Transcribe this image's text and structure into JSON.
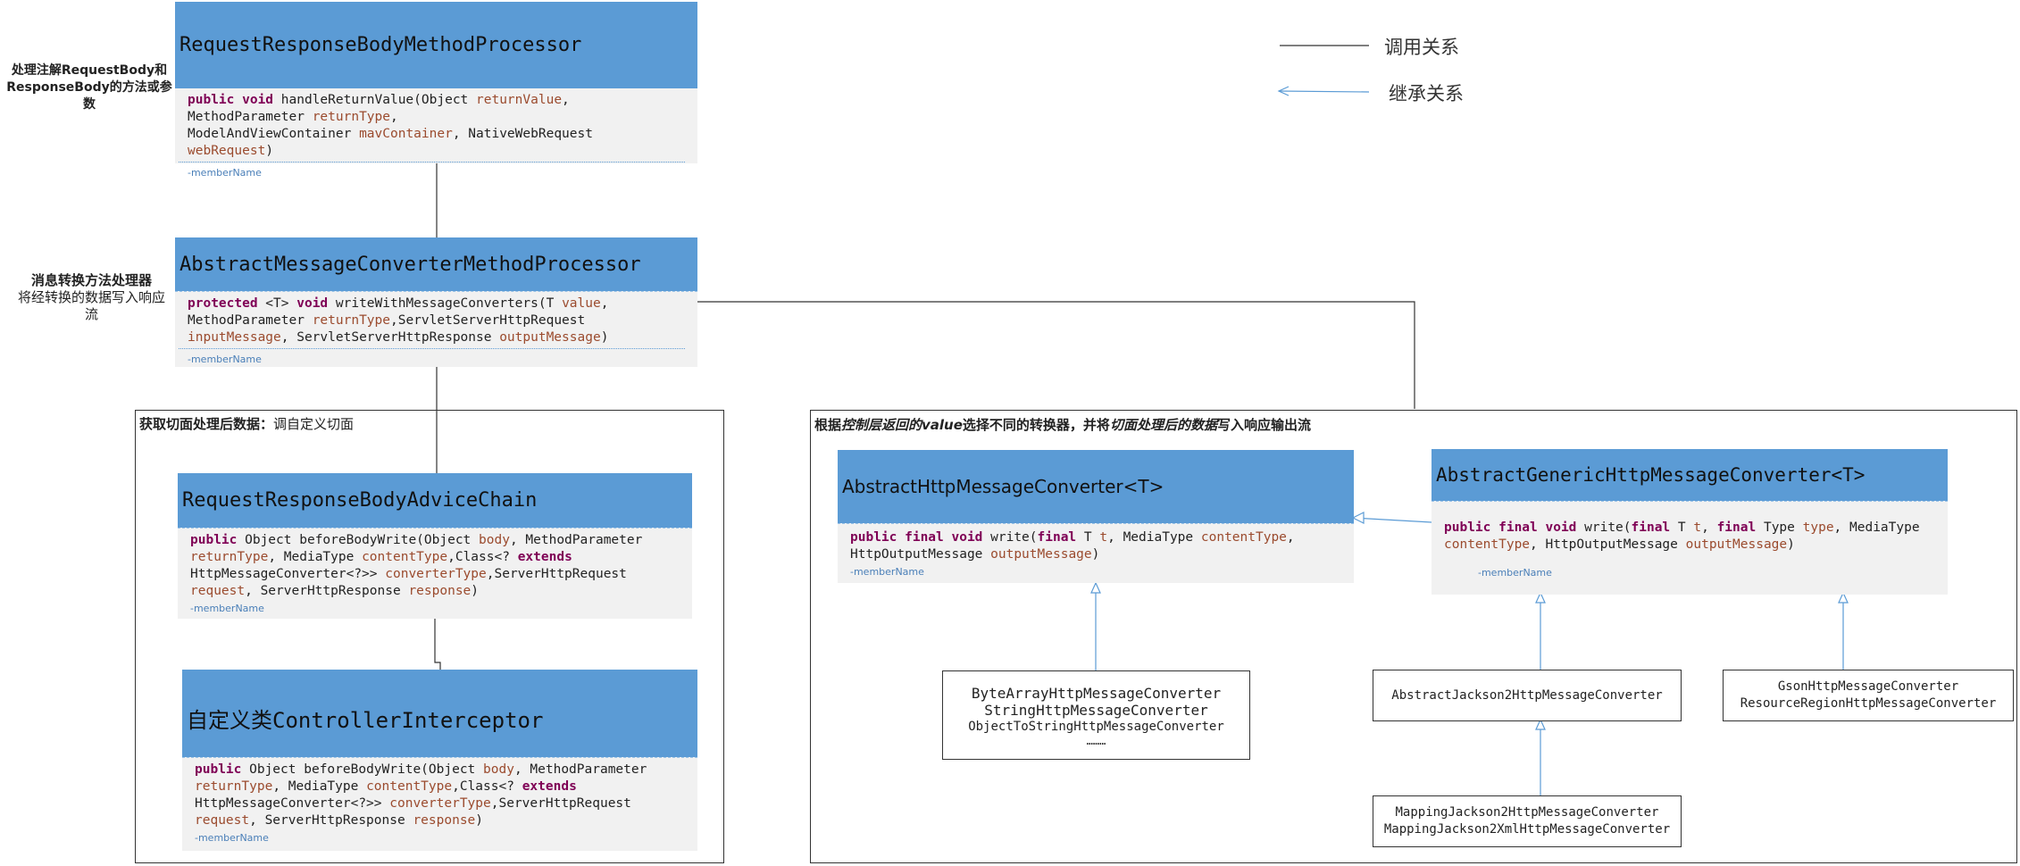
{
  "legend": {
    "call_label": "调用关系",
    "inherit_label": "继承关系"
  },
  "side_labels": {
    "processor_line1": "处理注解RequestBody和",
    "processor_line2": "ResponseBody的方法或参",
    "processor_line3": "数",
    "converter_title": "消息转换方法处理器",
    "converter_line1": "将经转换的数据写入响应",
    "converter_line2": "流"
  },
  "classes": {
    "rrbmp": {
      "name": "RequestResponseBodyMethodProcessor",
      "member": "-memberName"
    },
    "amcmp": {
      "name": "AbstractMessageConverterMethodProcessor",
      "member": "-memberName"
    },
    "rrbac": {
      "name": "RequestResponseBodyAdviceChain",
      "member": "-memberName"
    },
    "ci": {
      "name": "自定义类ControllerInterceptor",
      "member": "-memberName"
    },
    "ahmc": {
      "name": "AbstractHttpMessageConverter<T>",
      "member": "-memberName"
    },
    "aghmc": {
      "name": "AbstractGenericHttpMessageConverter<T>",
      "member": "-memberName"
    }
  },
  "groups": {
    "advice_title_bold": "获取切面处理后数据：",
    "advice_title_rest": "调自定义切面",
    "converter_title_1": "根据",
    "converter_title_2": "控制层返回的value",
    "converter_title_3": "选择不同的转换器，并将",
    "converter_title_4": "切面处理后的数据",
    "converter_title_5": "写入响应输出流"
  },
  "leaf_boxes": {
    "bytearray": [
      "ByteArrayHttpMessageConverter",
      "StringHttpMessageConverter",
      "ObjectToStringHttpMessageConverter",
      "………"
    ],
    "jackson": [
      "AbstractJackson2HttpMessageConverter"
    ],
    "gson": [
      "GsonHttpMessageConverter",
      "ResourceRegionHttpMessageConverter"
    ],
    "mapping": [
      "MappingJackson2HttpMessageConverter",
      "MappingJackson2XmlHttpMessageConverter"
    ]
  },
  "colors": {
    "header_blue": "#5b9bd5",
    "body_gray": "#f1f1f1",
    "inherit_arrow": "#5b9bd5",
    "call_line": "#333333"
  }
}
